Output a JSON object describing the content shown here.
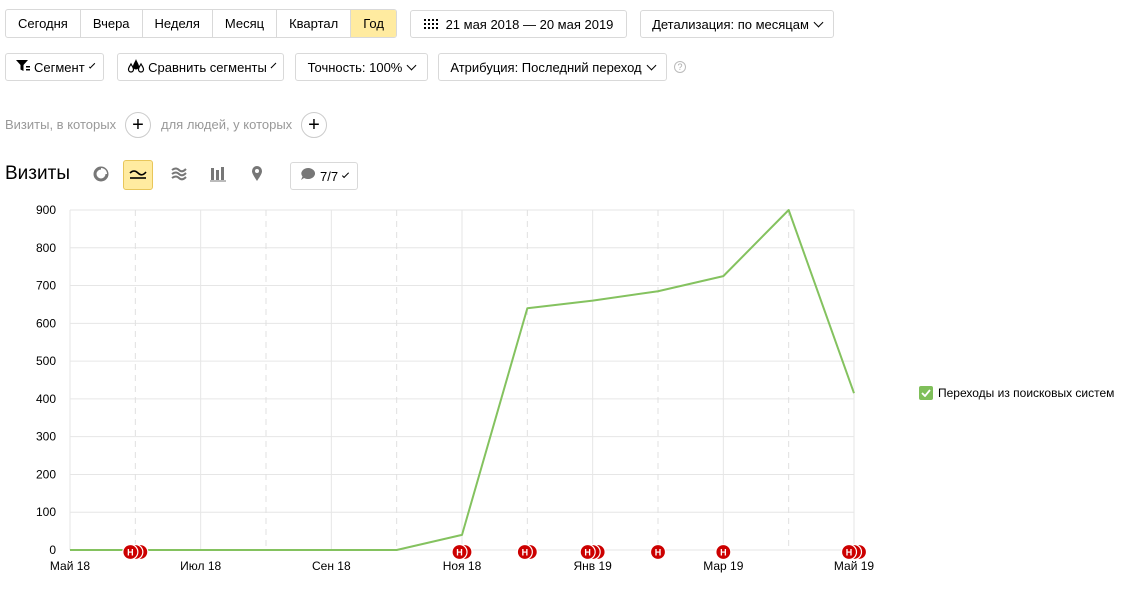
{
  "period_tabs": [
    {
      "label": "Сегодня",
      "active": false
    },
    {
      "label": "Вчера",
      "active": false
    },
    {
      "label": "Неделя",
      "active": false
    },
    {
      "label": "Месяц",
      "active": false
    },
    {
      "label": "Квартал",
      "active": false
    },
    {
      "label": "Год",
      "active": true
    }
  ],
  "date_range": "21 мая 2018 — 20 мая 2019",
  "detail": "Детализация: по месяцам",
  "segment": "Сегмент",
  "compare": "Сравнить сегменты",
  "accuracy": "Точность: 100%",
  "attribution": "Атрибуция: Последний переход",
  "filter_visits": "Визиты, в которых",
  "filter_people": "для людей, у которых",
  "title": "Визиты",
  "notes_count": "7/7",
  "legend_label": "Переходы из поисковых систем",
  "colors": {
    "series": "#84c25f",
    "active": "#ffeba0",
    "note": "#cc0000"
  },
  "chart_data": {
    "type": "line",
    "x": [
      "Май 18",
      "Июн 18",
      "Июл 18",
      "Авг 18",
      "Сен 18",
      "Окт 18",
      "Ноя 18",
      "Дек 18",
      "Янв 19",
      "Фев 19",
      "Мар 19",
      "Апр 19",
      "Май 19"
    ],
    "tick_labels": [
      "Май 18",
      "Июл 18",
      "Сен 18",
      "Ноя 18",
      "Янв 19",
      "Мар 19",
      "Май 19"
    ],
    "series": [
      {
        "name": "Переходы из поисковых систем",
        "values": [
          0,
          0,
          0,
          0,
          0,
          0,
          40,
          640,
          660,
          685,
          725,
          900,
          415
        ]
      }
    ],
    "ylim": [
      0,
      900
    ],
    "yticks": [
      0,
      100,
      200,
      300,
      400,
      500,
      600,
      700,
      800,
      900
    ],
    "notes": [
      {
        "x": "Июн 18",
        "count": 3
      },
      {
        "x": "Ноя 18",
        "count": 2
      },
      {
        "x": "Дек 18",
        "count": 2
      },
      {
        "x": "Янв 19",
        "count": 3
      },
      {
        "x": "Фев 19",
        "count": 1
      },
      {
        "x": "Мар 19",
        "count": 1
      },
      {
        "x": "Май 19",
        "count": 3
      }
    ],
    "note_letter": "Н",
    "grid": true
  }
}
